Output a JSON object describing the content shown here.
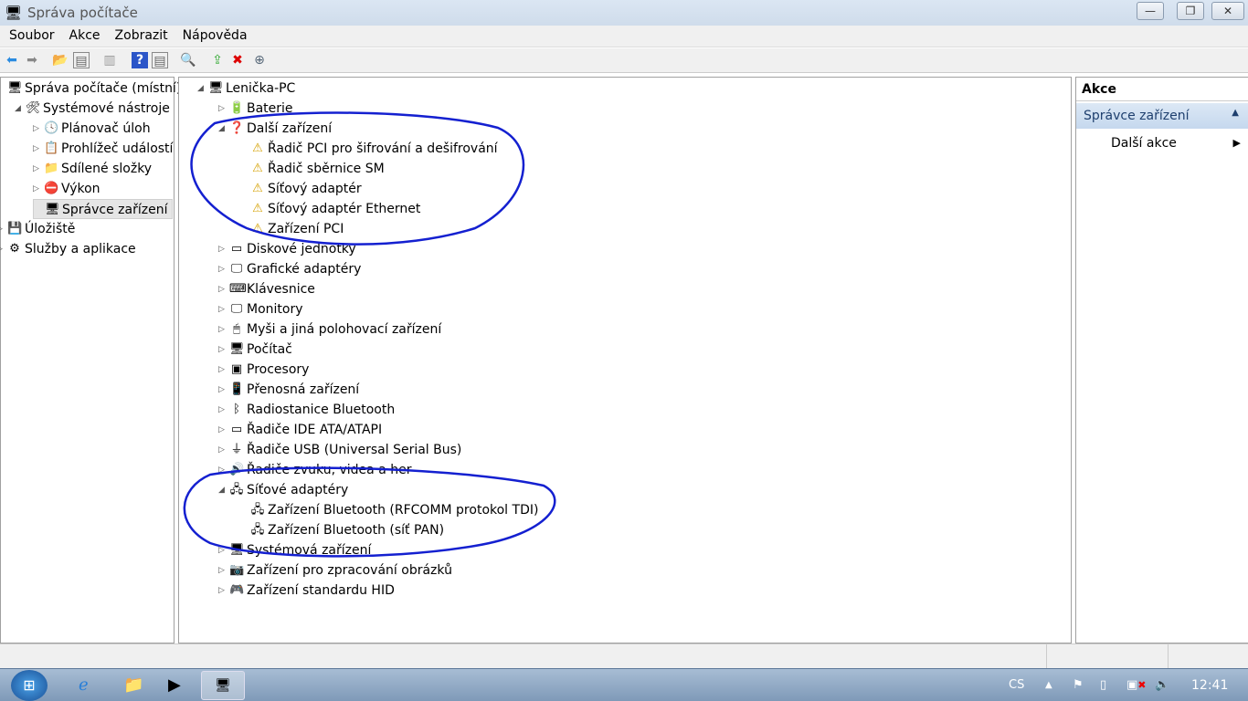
{
  "window": {
    "title": "Správa počítače",
    "min": "—",
    "max": "❐",
    "close": "✕"
  },
  "menu": [
    "Soubor",
    "Akce",
    "Zobrazit",
    "Nápověda"
  ],
  "left_tree": [
    {
      "label": "Správa počítače (místní)",
      "level": 0,
      "arrow": "",
      "icon": "computer-management-icon",
      "glyph": "🖥"
    },
    {
      "label": "Systémové nástroje",
      "level": 1,
      "arrow": "◢",
      "icon": "tools-icon",
      "glyph": "🛠"
    },
    {
      "label": "Plánovač úloh",
      "level": 2,
      "arrow": "▷",
      "icon": "clock-icon",
      "glyph": "🕓"
    },
    {
      "label": "Prohlížeč událostí",
      "level": 2,
      "arrow": "▷",
      "icon": "event-viewer-icon",
      "glyph": "📋"
    },
    {
      "label": "Sdílené složky",
      "level": 2,
      "arrow": "▷",
      "icon": "shared-folder-icon",
      "glyph": "📁"
    },
    {
      "label": "Výkon",
      "level": 2,
      "arrow": "▷",
      "icon": "performance-icon",
      "glyph": "⛔"
    },
    {
      "label": "Správce zařízení",
      "level": 2,
      "arrow": "",
      "icon": "device-manager-icon",
      "glyph": "🖥",
      "selected": true
    },
    {
      "label": "Úložiště",
      "level": 0,
      "arrow": "▷",
      "icon": "storage-icon",
      "glyph": "💾"
    },
    {
      "label": "Služby a aplikace",
      "level": 0,
      "arrow": "▷",
      "icon": "services-icon",
      "glyph": "⚙"
    }
  ],
  "device_tree": [
    {
      "label": "Lenička-PC",
      "level": 0,
      "arrow": "◢",
      "icon": "computer-icon",
      "glyph": "🖥"
    },
    {
      "label": "Baterie",
      "level": 1,
      "arrow": "▷",
      "icon": "battery-icon",
      "glyph": "🔋"
    },
    {
      "label": "Další zařízení",
      "level": 1,
      "arrow": "◢",
      "icon": "unknown-device-icon",
      "glyph": "❓"
    },
    {
      "label": "Řadič PCI pro šifrování a dešifrování",
      "level": 2,
      "arrow": "",
      "icon": "warning-device-icon",
      "glyph": "⚠"
    },
    {
      "label": "Řadič sběrnice SM",
      "level": 2,
      "arrow": "",
      "icon": "warning-device-icon",
      "glyph": "⚠"
    },
    {
      "label": "Síťový adaptér",
      "level": 2,
      "arrow": "",
      "icon": "warning-device-icon",
      "glyph": "⚠"
    },
    {
      "label": "Síťový adaptér Ethernet",
      "level": 2,
      "arrow": "",
      "icon": "warning-device-icon",
      "glyph": "⚠"
    },
    {
      "label": "Zařízení PCI",
      "level": 2,
      "arrow": "",
      "icon": "warning-device-icon",
      "glyph": "⚠"
    },
    {
      "label": "Diskové jednotky",
      "level": 1,
      "arrow": "▷",
      "icon": "disk-icon",
      "glyph": "▭"
    },
    {
      "label": "Grafické adaptéry",
      "level": 1,
      "arrow": "▷",
      "icon": "display-adapter-icon",
      "glyph": "🖵"
    },
    {
      "label": "Klávesnice",
      "level": 1,
      "arrow": "▷",
      "icon": "keyboard-icon",
      "glyph": "⌨"
    },
    {
      "label": "Monitory",
      "level": 1,
      "arrow": "▷",
      "icon": "monitor-icon",
      "glyph": "🖵"
    },
    {
      "label": "Myši a jiná polohovací zařízení",
      "level": 1,
      "arrow": "▷",
      "icon": "mouse-icon",
      "glyph": "🖱"
    },
    {
      "label": "Počítač",
      "level": 1,
      "arrow": "▷",
      "icon": "computer-icon",
      "glyph": "🖥"
    },
    {
      "label": "Procesory",
      "level": 1,
      "arrow": "▷",
      "icon": "processor-icon",
      "glyph": "▣"
    },
    {
      "label": "Přenosná zařízení",
      "level": 1,
      "arrow": "▷",
      "icon": "portable-device-icon",
      "glyph": "📱"
    },
    {
      "label": "Radiostanice Bluetooth",
      "level": 1,
      "arrow": "▷",
      "icon": "bluetooth-icon",
      "glyph": "ᛒ"
    },
    {
      "label": "Řadiče IDE ATA/ATAPI",
      "level": 1,
      "arrow": "▷",
      "icon": "ide-icon",
      "glyph": "▭"
    },
    {
      "label": "Řadiče USB (Universal Serial Bus)",
      "level": 1,
      "arrow": "▷",
      "icon": "usb-icon",
      "glyph": "⏚"
    },
    {
      "label": "Řadiče zvuku, videa a her",
      "level": 1,
      "arrow": "▷",
      "icon": "sound-icon",
      "glyph": "🔊"
    },
    {
      "label": "Síťové adaptéry",
      "level": 1,
      "arrow": "◢",
      "icon": "network-adapter-icon",
      "glyph": "🖧"
    },
    {
      "label": "Zařízení Bluetooth (RFCOMM protokol TDI)",
      "level": 2,
      "arrow": "",
      "icon": "network-adapter-icon",
      "glyph": "🖧"
    },
    {
      "label": "Zařízení Bluetooth (síť PAN)",
      "level": 2,
      "arrow": "",
      "icon": "network-adapter-icon",
      "glyph": "🖧"
    },
    {
      "label": "Systémová zařízení",
      "level": 1,
      "arrow": "▷",
      "icon": "system-device-icon",
      "glyph": "🖥"
    },
    {
      "label": "Zařízení pro zpracování obrázků",
      "level": 1,
      "arrow": "▷",
      "icon": "camera-icon",
      "glyph": "📷"
    },
    {
      "label": "Zařízení standardu HID",
      "level": 1,
      "arrow": "▷",
      "icon": "hid-icon",
      "glyph": "🎮"
    }
  ],
  "actions": {
    "header": "Akce",
    "section": "Správce zařízení",
    "more": "Další akce"
  },
  "tray": {
    "lang": "CS",
    "time": "12:41"
  }
}
